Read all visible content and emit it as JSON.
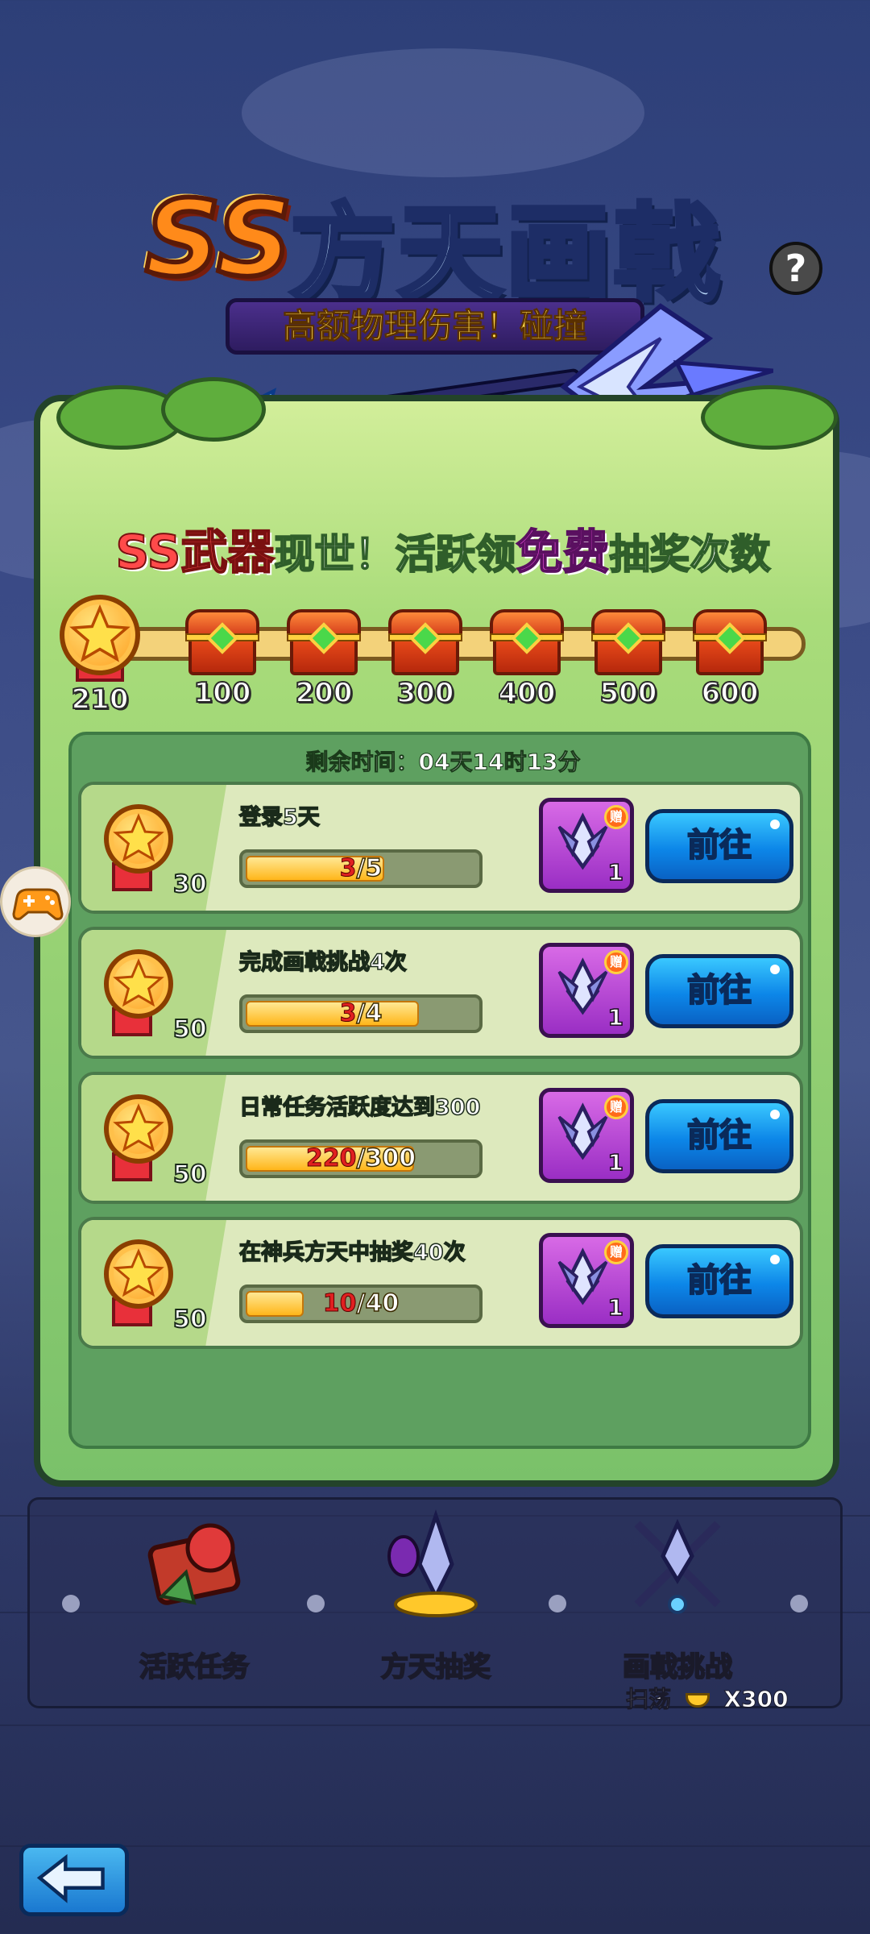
{
  "logo": {
    "ss": "SS",
    "name": "方天画戟",
    "subtitle": "高额物理伤害！碰撞"
  },
  "help": {
    "label": "?"
  },
  "headline": {
    "part1": "SS武器",
    "part2": "现世！活跃领",
    "part3": "免费",
    "part4": "抽奖次数"
  },
  "activity": {
    "current_points": "210",
    "milestones": [
      "100",
      "200",
      "300",
      "400",
      "500",
      "600"
    ]
  },
  "timer": "剩余时间：04天14时13分",
  "tasks": [
    {
      "points": "30",
      "title": "登录5天",
      "current": "3",
      "target": "/5",
      "fraction": 0.6,
      "reward_badge": "赠",
      "reward_count": "1",
      "button": "前往"
    },
    {
      "points": "50",
      "title": "完成画戟挑战4次",
      "current": "3",
      "target": "/4",
      "fraction": 0.75,
      "reward_badge": "赠",
      "reward_count": "1",
      "button": "前往"
    },
    {
      "points": "50",
      "title": "日常任务活跃度达到300",
      "current": "220",
      "target": "/300",
      "fraction": 0.73,
      "reward_badge": "赠",
      "reward_count": "1",
      "button": "前往"
    },
    {
      "points": "50",
      "title": "在神兵方天中抽奖40次",
      "current": "10",
      "target": "/40",
      "fraction": 0.25,
      "reward_badge": "赠",
      "reward_count": "1",
      "button": "前往"
    }
  ],
  "bottom": {
    "tabs": [
      {
        "label": "活跃任务",
        "icon": "rose-scroll-icon"
      },
      {
        "label": "方天抽奖",
        "icon": "halberd-treasure-icon"
      },
      {
        "label": "画戟挑战",
        "icon": "crossed-halberd-icon"
      }
    ],
    "sweep_label": "扫荡",
    "sweep_cost": "X300"
  },
  "colors": {
    "panel": "#a9dc7a",
    "button_blue": "#0c86e8",
    "reward_purple": "#9a2ec4",
    "progress_gold": "#ffb61a"
  }
}
